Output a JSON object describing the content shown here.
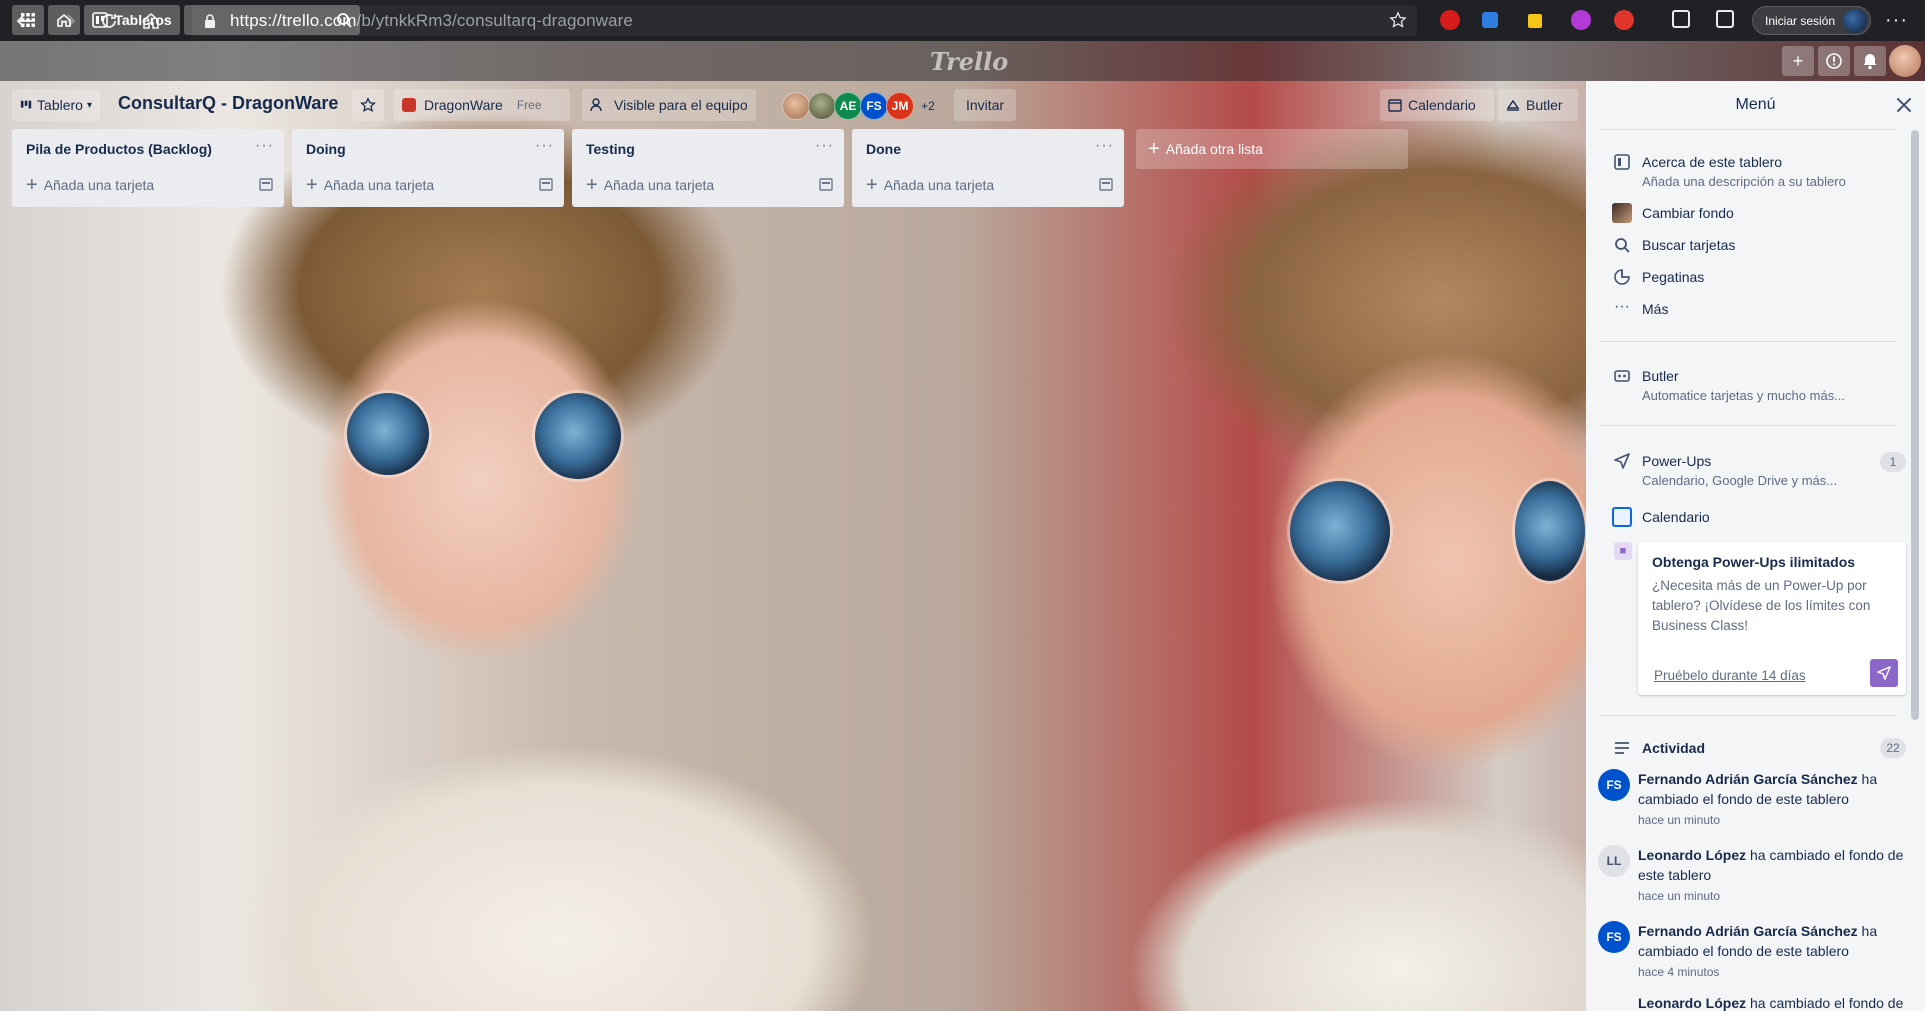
{
  "browser": {
    "url_host": "https://trello.com",
    "url_path": "/b/ytnkkRm3/consultarq-dragonware",
    "login_label": "Iniciar sesión"
  },
  "header": {
    "boards_label": "Tableros",
    "logo": "Trello"
  },
  "board": {
    "view_label": "Tablero",
    "title": "ConsultarQ - DragonWare",
    "team_name": "DragonWare",
    "team_plan": "Free",
    "visibility": "Visible para el equipo",
    "members": [
      {
        "initials": "AE",
        "color": "#0f8a4e"
      },
      {
        "initials": "FS",
        "color": "#0052cc"
      },
      {
        "initials": "JM",
        "color": "#d9331a"
      }
    ],
    "more_members": "+2",
    "invite_label": "Invitar",
    "calendar_label": "Calendario",
    "butler_label": "Butler"
  },
  "lists": [
    {
      "title": "Pila de Productos (Backlog)",
      "add_label": "Añada una tarjeta"
    },
    {
      "title": "Doing",
      "add_label": "Añada una tarjeta"
    },
    {
      "title": "Testing",
      "add_label": "Añada una tarjeta"
    },
    {
      "title": "Done",
      "add_label": "Añada una tarjeta"
    }
  ],
  "add_list_label": "Añada otra lista",
  "menu": {
    "title": "Menú",
    "about": {
      "label": "Acerca de este tablero",
      "sub": "Añada una descripción a su tablero"
    },
    "change_bg": "Cambiar fondo",
    "search_cards": "Buscar tarjetas",
    "stickers": "Pegatinas",
    "more": "Más",
    "butler": {
      "label": "Butler",
      "sub": "Automatice tarjetas y mucho más..."
    },
    "powerups": {
      "label": "Power-Ups",
      "sub": "Calendario, Google Drive y más...",
      "count": "1"
    },
    "calendar": "Calendario",
    "promo": {
      "title": "Obtenga Power-Ups ilimitados",
      "body": "¿Necesita más de un Power-Up por tablero? ¡Olvídese de los límites con Business Class!",
      "link": "Pruébelo durante 14 días"
    },
    "activity": {
      "label": "Actividad",
      "count": "22",
      "items": [
        {
          "initials": "FS",
          "color": "#0052cc",
          "name": "Fernando Adrián García Sánchez",
          "action": " ha cambiado el fondo de este tablero",
          "time": "hace un minuto"
        },
        {
          "initials": "LL",
          "color": "#dfe1e6",
          "name": "Leonardo López",
          "action": " ha cambiado el fondo de este tablero",
          "time": "hace un minuto"
        },
        {
          "initials": "FS",
          "color": "#0052cc",
          "name": "Fernando Adrián García Sánchez",
          "action": " ha cambiado el fondo de este tablero",
          "time": "hace 4 minutos"
        },
        {
          "initials": "LL",
          "color": "#dfe1e6",
          "name": "Leonardo López",
          "action": " ha cambiado el fondo de este tablero",
          "time": ""
        }
      ]
    }
  }
}
